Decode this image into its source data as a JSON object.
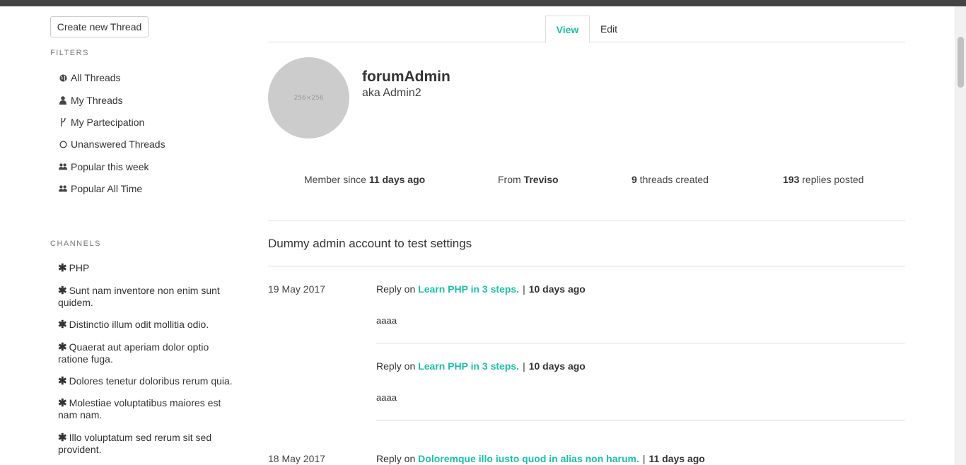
{
  "sidebar": {
    "create_button": "Create new Thread",
    "filters_title": "FILTERS",
    "filters": [
      {
        "label": "All Threads",
        "icon": "globe-icon"
      },
      {
        "label": "My Threads",
        "icon": "user-icon"
      },
      {
        "label": "My Partecipation",
        "icon": "branch-icon"
      },
      {
        "label": "Unanswered Threads",
        "icon": "circle-icon"
      },
      {
        "label": "Popular this week",
        "icon": "users-icon"
      },
      {
        "label": "Popular All Time",
        "icon": "users-icon"
      }
    ],
    "channels_title": "CHANNELS",
    "channels": [
      {
        "label": "PHP"
      },
      {
        "label": "Sunt nam inventore non enim sunt quidem."
      },
      {
        "label": "Distinctio illum odit mollitia odio."
      },
      {
        "label": "Quaerat aut aperiam dolor optio ratione fuga."
      },
      {
        "label": "Dolores tenetur doloribus rerum quia."
      },
      {
        "label": "Molestiae voluptatibus maiores est nam nam."
      },
      {
        "label": "Illo voluptatum sed rerum sit sed provident."
      }
    ]
  },
  "tabs": {
    "view": "View",
    "edit": "Edit"
  },
  "profile": {
    "avatar_text": "256×256",
    "username": "forumAdmin",
    "aka": "aka Admin2",
    "stats": {
      "member_prefix": "Member since ",
      "member_value": "11 days ago",
      "from_prefix": "From ",
      "from_value": "Treviso",
      "threads_value": "9",
      "threads_suffix": " threads created",
      "replies_value": "193",
      "replies_suffix": " replies posted"
    },
    "bio": "Dummy admin account to test settings"
  },
  "activity": [
    {
      "date": "19 May 2017",
      "prefix": "Reply on ",
      "thread": "Learn PHP in 3 steps.",
      "sep": "|",
      "ago": "10 days ago",
      "body": "aaaa"
    },
    {
      "date": "",
      "prefix": "Reply on ",
      "thread": "Learn PHP in 3 steps.",
      "sep": "|",
      "ago": "10 days ago",
      "body": "aaaa"
    },
    {
      "date": "18 May 2017",
      "prefix": "Reply on ",
      "thread": "Doloremque illo iusto quod in alias non harum.",
      "sep": "|",
      "ago": "11 days ago",
      "body": ""
    }
  ],
  "colors": {
    "accent": "#1cbfa6",
    "topbar": "#444444",
    "avatar": "#cccccc"
  }
}
